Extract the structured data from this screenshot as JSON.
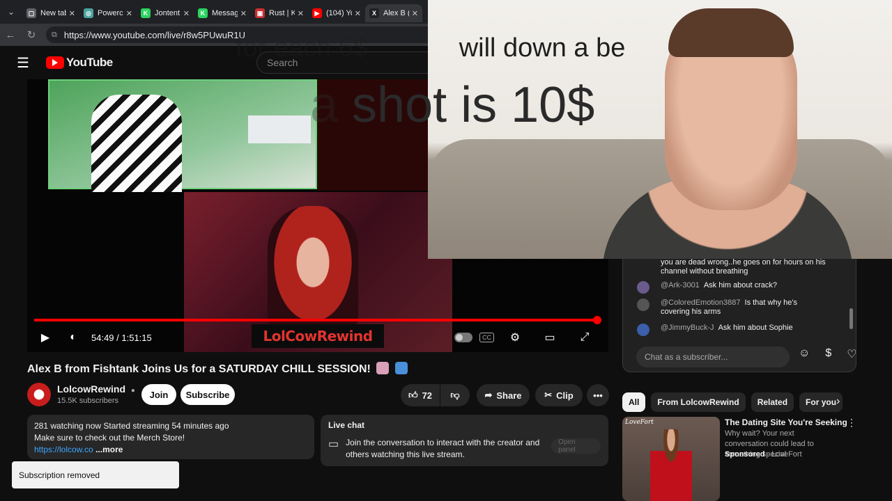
{
  "browser": {
    "tabs": [
      {
        "label": "New tab",
        "color": "#5f6368",
        "glyph": "▢"
      },
      {
        "label": "Powerch",
        "color": "#4aa3a0",
        "glyph": "◎"
      },
      {
        "label": "Jontent",
        "color": "#2bd45f",
        "glyph": "K"
      },
      {
        "label": "Messag",
        "color": "#2bd45f",
        "glyph": "K"
      },
      {
        "label": "Rust | K",
        "color": "#c62f2f",
        "glyph": "▣"
      },
      {
        "label": "(104) Yo",
        "color": "#ff0000",
        "glyph": "▶"
      },
      {
        "label": "Alex B (",
        "color": "#202124",
        "glyph": "X"
      }
    ],
    "url": "https://www.youtube.com/live/r8w5PUwuR1U"
  },
  "youtube": {
    "logo_text": "YouTube",
    "search_placeholder": "Search"
  },
  "player": {
    "current_time": "54:49",
    "duration": "1:51:15",
    "time_display": "54:49 / 1:51:15",
    "progress_fraction": 0.995,
    "overlay_brand": "LolCowRewind"
  },
  "video_info": {
    "title": "Alex B from Fishtank Joins Us for a SATURDAY CHILL SESSION!",
    "channel_name": "LolcowRewind",
    "subscribers": "15.5K subscribers",
    "join_label": "Join",
    "subscribe_label": "Subscribe",
    "likes": "72",
    "share_label": "Share",
    "clip_label": "Clip"
  },
  "description": {
    "stats": "281 watching now  Started streaming 54 minutes ago",
    "line2": "Make sure to check out the Merch Store!",
    "link": "https://lolcow.co",
    "more": "...more"
  },
  "live_chat_box": {
    "heading": "Live chat",
    "text": "Join the conversation to interact with the creator and others watching this live stream.",
    "button": "Open panel"
  },
  "toast": {
    "text": "Subscription removed"
  },
  "chat": {
    "messages": [
      {
        "user": "",
        "text": "you are dead wrong..he goes on for hours on his channel without breathing",
        "avatar_color": "#212121"
      },
      {
        "user": "@Ark-3001",
        "text": "Ask him about crack?",
        "avatar_color": "#6b5a8c"
      },
      {
        "user": "@ColoredEmotion3887",
        "text": "Is that why he's covering his arms",
        "avatar_color": "#555555"
      },
      {
        "user": "@JimmyBuck-J",
        "text": "Ask him about Sophie",
        "avatar_color": "#3b5fa8"
      }
    ],
    "input_placeholder": "Chat as a subscriber..."
  },
  "related": {
    "chips": [
      "All",
      "From LolcowRewind",
      "Related",
      "For you"
    ],
    "ad": {
      "brand": "LoveFort",
      "title": "The Dating Site You're Seeking",
      "description": "Why wait? Your next conversation could lead to something special",
      "sponsored": "Sponsored",
      "advertiser": "LoveFort"
    }
  },
  "webcam_overlay": {
    "line1_faded": "for each 6$ ",
    "line1": "will down a beer",
    "line2_faded": "a ",
    "line2": "shot is 10$"
  },
  "colors": {
    "accent_red": "#ff0000",
    "link_blue": "#3ea6ff",
    "background": "#0f0f0f"
  }
}
